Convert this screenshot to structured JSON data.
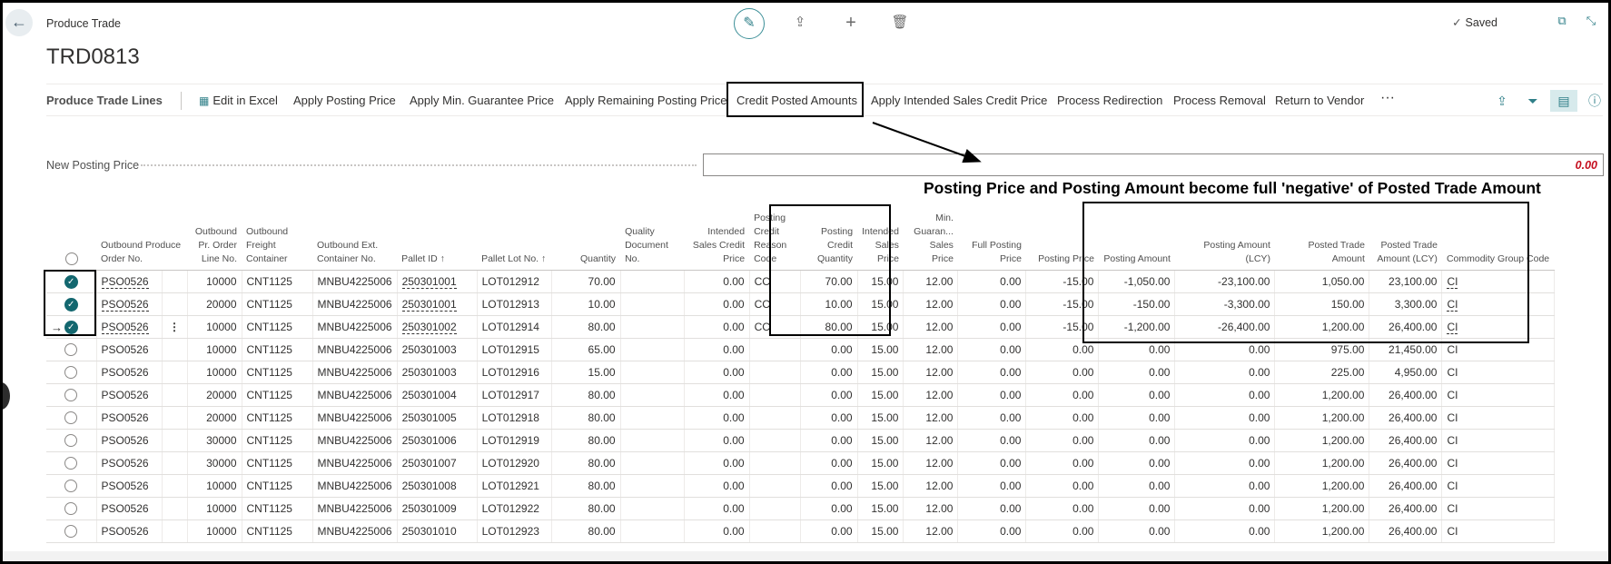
{
  "header": {
    "breadcrumb": "Produce Trade",
    "title": "TRD0813",
    "saved_label": "Saved"
  },
  "toolbar": {
    "title": "Produce Trade Lines",
    "buttons": [
      "Edit in Excel",
      "Apply Posting Price",
      "Apply Min. Guarantee Price",
      "Apply Remaining Posting Price",
      "Credit Posted Amounts",
      "Apply Intended Sales Credit Price",
      "Process Redirection",
      "Process Removal",
      "Return to Vendor"
    ],
    "more": "···"
  },
  "field": {
    "label": "New Posting Price",
    "value": "0.00"
  },
  "annotation": "Posting Price and Posting Amount become full 'negative' of Posted Trade Amount",
  "columns": [
    "Outbound Produce Order No.",
    "Outbound Pr. Order Line No.",
    "Outbound Freight Container",
    "Outbound Ext. Container No.",
    "Pallet ID ↑",
    "Pallet Lot No. ↑",
    "Quantity",
    "Quality Document No.",
    "Intended Sales Credit Price",
    "Posting Credit Reason Code",
    "Posting Credit Quantity",
    "Intended Sales Price",
    "Min. Guaran... Sales Price",
    "Full Posting Price",
    "Posting Price",
    "Posting Amount",
    "Posting Amount (LCY)",
    "Posted Trade Amount",
    "Posted Trade Amount (LCY)",
    "Commodity Group Code"
  ],
  "rows": [
    {
      "sel": true,
      "order": "PSO0526",
      "line": "10000",
      "freight": "CNT1125",
      "ext": "MNBU4225006",
      "pallet": "250301001",
      "lot": "LOT012912",
      "qty": "70.00",
      "qdoc": "",
      "iscp": "0.00",
      "reason": "CC",
      "pcq": "70.00",
      "isp": "15.00",
      "mgsp": "12.00",
      "fpp": "0.00",
      "pp": "-15.00",
      "pa": "-1,050.00",
      "palcy": "-23,100.00",
      "pta": "1,050.00",
      "ptalcy": "23,100.00",
      "cg": "CI"
    },
    {
      "sel": true,
      "order": "PSO0526",
      "line": "20000",
      "freight": "CNT1125",
      "ext": "MNBU4225006",
      "pallet": "250301001",
      "lot": "LOT012913",
      "qty": "10.00",
      "qdoc": "",
      "iscp": "0.00",
      "reason": "CC",
      "pcq": "10.00",
      "isp": "15.00",
      "mgsp": "12.00",
      "fpp": "0.00",
      "pp": "-15.00",
      "pa": "-150.00",
      "palcy": "-3,300.00",
      "pta": "150.00",
      "ptalcy": "3,300.00",
      "cg": "CI"
    },
    {
      "sel": true,
      "order": "PSO0526",
      "line": "10000",
      "freight": "CNT1125",
      "ext": "MNBU4225006",
      "pallet": "250301002",
      "lot": "LOT012914",
      "qty": "80.00",
      "qdoc": "",
      "iscp": "0.00",
      "reason": "CC",
      "pcq": "80.00",
      "isp": "15.00",
      "mgsp": "12.00",
      "fpp": "0.00",
      "pp": "-15.00",
      "pa": "-1,200.00",
      "palcy": "-26,400.00",
      "pta": "1,200.00",
      "ptalcy": "26,400.00",
      "cg": "CI"
    },
    {
      "sel": false,
      "order": "PSO0526",
      "line": "10000",
      "freight": "CNT1125",
      "ext": "MNBU4225006",
      "pallet": "250301003",
      "lot": "LOT012915",
      "qty": "65.00",
      "qdoc": "",
      "iscp": "0.00",
      "reason": "",
      "pcq": "0.00",
      "isp": "15.00",
      "mgsp": "12.00",
      "fpp": "0.00",
      "pp": "0.00",
      "pa": "0.00",
      "palcy": "0.00",
      "pta": "975.00",
      "ptalcy": "21,450.00",
      "cg": "CI"
    },
    {
      "sel": false,
      "order": "PSO0526",
      "line": "10000",
      "freight": "CNT1125",
      "ext": "MNBU4225006",
      "pallet": "250301003",
      "lot": "LOT012916",
      "qty": "15.00",
      "qdoc": "",
      "iscp": "0.00",
      "reason": "",
      "pcq": "0.00",
      "isp": "15.00",
      "mgsp": "12.00",
      "fpp": "0.00",
      "pp": "0.00",
      "pa": "0.00",
      "palcy": "0.00",
      "pta": "225.00",
      "ptalcy": "4,950.00",
      "cg": "CI"
    },
    {
      "sel": false,
      "order": "PSO0526",
      "line": "20000",
      "freight": "CNT1125",
      "ext": "MNBU4225006",
      "pallet": "250301004",
      "lot": "LOT012917",
      "qty": "80.00",
      "qdoc": "",
      "iscp": "0.00",
      "reason": "",
      "pcq": "0.00",
      "isp": "15.00",
      "mgsp": "12.00",
      "fpp": "0.00",
      "pp": "0.00",
      "pa": "0.00",
      "palcy": "0.00",
      "pta": "1,200.00",
      "ptalcy": "26,400.00",
      "cg": "CI"
    },
    {
      "sel": false,
      "order": "PSO0526",
      "line": "20000",
      "freight": "CNT1125",
      "ext": "MNBU4225006",
      "pallet": "250301005",
      "lot": "LOT012918",
      "qty": "80.00",
      "qdoc": "",
      "iscp": "0.00",
      "reason": "",
      "pcq": "0.00",
      "isp": "15.00",
      "mgsp": "12.00",
      "fpp": "0.00",
      "pp": "0.00",
      "pa": "0.00",
      "palcy": "0.00",
      "pta": "1,200.00",
      "ptalcy": "26,400.00",
      "cg": "CI"
    },
    {
      "sel": false,
      "order": "PSO0526",
      "line": "30000",
      "freight": "CNT1125",
      "ext": "MNBU4225006",
      "pallet": "250301006",
      "lot": "LOT012919",
      "qty": "80.00",
      "qdoc": "",
      "iscp": "0.00",
      "reason": "",
      "pcq": "0.00",
      "isp": "15.00",
      "mgsp": "12.00",
      "fpp": "0.00",
      "pp": "0.00",
      "pa": "0.00",
      "palcy": "0.00",
      "pta": "1,200.00",
      "ptalcy": "26,400.00",
      "cg": "CI"
    },
    {
      "sel": false,
      "order": "PSO0526",
      "line": "30000",
      "freight": "CNT1125",
      "ext": "MNBU4225006",
      "pallet": "250301007",
      "lot": "LOT012920",
      "qty": "80.00",
      "qdoc": "",
      "iscp": "0.00",
      "reason": "",
      "pcq": "0.00",
      "isp": "15.00",
      "mgsp": "12.00",
      "fpp": "0.00",
      "pp": "0.00",
      "pa": "0.00",
      "palcy": "0.00",
      "pta": "1,200.00",
      "ptalcy": "26,400.00",
      "cg": "CI"
    },
    {
      "sel": false,
      "order": "PSO0526",
      "line": "10000",
      "freight": "CNT1125",
      "ext": "MNBU4225006",
      "pallet": "250301008",
      "lot": "LOT012921",
      "qty": "80.00",
      "qdoc": "",
      "iscp": "0.00",
      "reason": "",
      "pcq": "0.00",
      "isp": "15.00",
      "mgsp": "12.00",
      "fpp": "0.00",
      "pp": "0.00",
      "pa": "0.00",
      "palcy": "0.00",
      "pta": "1,200.00",
      "ptalcy": "26,400.00",
      "cg": "CI"
    },
    {
      "sel": false,
      "order": "PSO0526",
      "line": "10000",
      "freight": "CNT1125",
      "ext": "MNBU4225006",
      "pallet": "250301009",
      "lot": "LOT012922",
      "qty": "80.00",
      "qdoc": "",
      "iscp": "0.00",
      "reason": "",
      "pcq": "0.00",
      "isp": "15.00",
      "mgsp": "12.00",
      "fpp": "0.00",
      "pp": "0.00",
      "pa": "0.00",
      "palcy": "0.00",
      "pta": "1,200.00",
      "ptalcy": "26,400.00",
      "cg": "CI"
    },
    {
      "sel": false,
      "order": "PSO0526",
      "line": "10000",
      "freight": "CNT1125",
      "ext": "MNBU4225006",
      "pallet": "250301010",
      "lot": "LOT012923",
      "qty": "80.00",
      "qdoc": "",
      "iscp": "0.00",
      "reason": "",
      "pcq": "0.00",
      "isp": "15.00",
      "mgsp": "12.00",
      "fpp": "0.00",
      "pp": "0.00",
      "pa": "0.00",
      "palcy": "0.00",
      "pta": "1,200.00",
      "ptalcy": "26,400.00",
      "cg": "CI"
    }
  ],
  "colors": {
    "accent": "#13676f",
    "negative_value": "#c50f1f"
  }
}
